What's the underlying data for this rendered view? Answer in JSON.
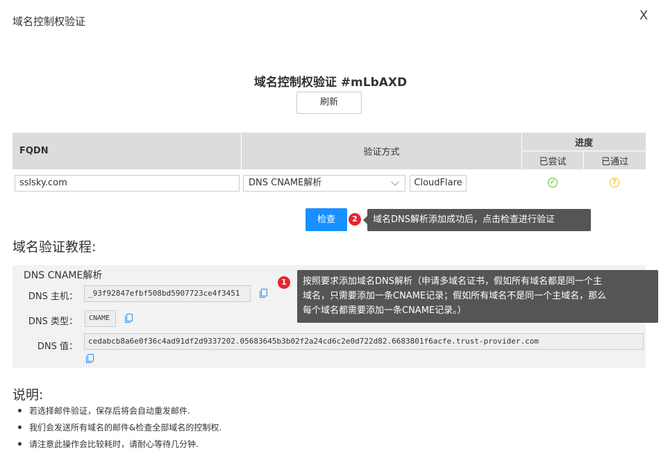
{
  "dialog": {
    "title": "域名控制权验证",
    "close_label": "X"
  },
  "main": {
    "title": "域名控制权验证 #mLbAXD",
    "refresh_label": "刷新"
  },
  "table": {
    "headers": {
      "fqdn": "FQDN",
      "method": "验证方式",
      "progress": "进度",
      "tried": "已尝试",
      "passed": "已通过"
    },
    "row": {
      "domain": "sslsky.com",
      "method": "DNS CNAME解析",
      "provider": "CloudFlare",
      "tried_status": "ok",
      "passed_status": "pending"
    }
  },
  "check": {
    "label": "检查",
    "badge": "2",
    "tip": "域名DNS解析添加成功后，点击检查进行验证"
  },
  "tutorial": {
    "title": "域名验证教程:",
    "heading": "DNS CNAME解析",
    "host_label": "DNS 主机：",
    "host_value": "_93f92847efbf508bd5907723ce4f3451",
    "type_label": "DNS 类型：",
    "type_value": "CNAME",
    "value_label": "DNS 值：",
    "value_value": "cedabcb8a6e0f36c4ad91df2d9337202.05683645b3b02f2a24cd6c2e0d722d82.6683801f6acfe.trust-provider.com",
    "badge": "1",
    "tip_lines": [
      "按照要求添加域名DNS解析（申请多域名证书，假如所有域名都是同一个主",
      "域名，只需要添加一条CNAME记录；假如所有域名不是同一个主域名，那么",
      "每个域名都需要添加一条CNAME记录。）"
    ]
  },
  "notes": {
    "title": "说明:",
    "items": [
      "若选择邮件验证，保存后将会自动重发邮件.",
      "我们会发送所有域名的邮件&检查全部域名的控制权.",
      "请注意此操作会比较耗时，请耐心等待几分钟."
    ]
  },
  "colors": {
    "primary": "#1890ff",
    "badge": "#e8242f",
    "success": "#52c41a",
    "warning": "#f5c518",
    "tooltip": "#555555"
  }
}
